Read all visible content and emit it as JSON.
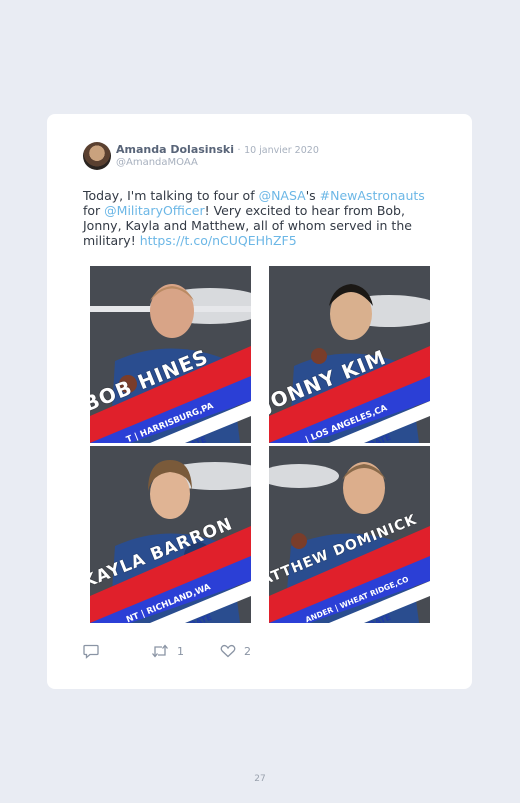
{
  "tweet": {
    "author_name": "Amanda Dolasinski",
    "separator": "·",
    "date": "10 janvier 2020",
    "handle": "@AmandaMOAA",
    "text_parts": [
      {
        "text": "Today, I'm talking to four of ",
        "link": false
      },
      {
        "text": "@NASA",
        "link": true
      },
      {
        "text": "'s ",
        "link": false
      },
      {
        "text": "#NewAstronauts",
        "link": true
      },
      {
        "text": " for ",
        "link": false
      },
      {
        "text": "@MilitaryOfficer",
        "link": true
      },
      {
        "text": "! Very excited to hear from Bob, Jonny, Kayla and Matthew, all of whom served in the military! ",
        "link": false
      },
      {
        "text": "https://t.co/nCUQEHhZF5",
        "link": true
      }
    ],
    "link_color": "#6cb7e6"
  },
  "photos": [
    {
      "name": "BOB HINES",
      "location": "T | HARRISBURG,PA",
      "role": "ANDIDATE"
    },
    {
      "name": "JONNY KIM",
      "location": "| LOS ANGELES,CA",
      "role": "CANDIDATE"
    },
    {
      "name": "KAYLA BARRON",
      "location": "NT | RICHLAND,WA",
      "role": "CANDIDATE"
    },
    {
      "name": "ATTHEW DOMINICK",
      "location": "ANDER | WHEAT RIDGE,CO",
      "role": "CANDIDATE"
    }
  ],
  "actions": {
    "reply_icon": "speech-bubble-icon",
    "retweet_icon": "retweet-arrows-icon",
    "retweet_count": "1",
    "like_icon": "heart-icon",
    "like_count": "2"
  },
  "page_number": "27",
  "colors": {
    "banner_red": "#e0202b",
    "banner_blue": "#2b3fd6",
    "suit_blue": "#2a4d8f"
  }
}
